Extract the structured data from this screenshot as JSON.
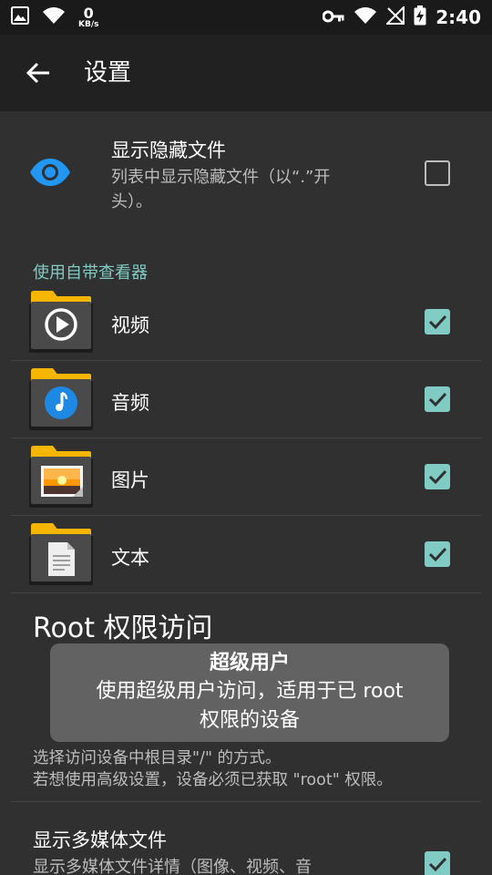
{
  "status_bar": {
    "net_speed_value": "0",
    "net_speed_unit": "KB/s",
    "time": "2:40"
  },
  "app_bar": {
    "title": "设置"
  },
  "hidden_files": {
    "title": "显示隐藏文件",
    "summary_line1": "列表中显示隐藏文件（以“.”开",
    "summary_line2": "头）。",
    "checked": false
  },
  "viewer_category": "使用自带查看器",
  "viewers": [
    {
      "label": "视频",
      "icon": "video-folder-icon",
      "checked": true
    },
    {
      "label": "音频",
      "icon": "audio-folder-icon",
      "checked": true
    },
    {
      "label": "图片",
      "icon": "image-folder-icon",
      "checked": true
    },
    {
      "label": "文本",
      "icon": "text-folder-icon",
      "checked": true
    }
  ],
  "root_access": {
    "title": "Root 权限访问",
    "summary_line1": "选择访问设备中根目录\"/\" 的方式。",
    "summary_line2": "若想使用高级设置，设备必须已获取 \"root\" 权限。"
  },
  "tooltip": {
    "title": "超级用户",
    "line1": "使用超级用户访问，适用于已 root",
    "line2": "权限的设备"
  },
  "media_files": {
    "title": "显示多媒体文件",
    "summary_line1": "显示多媒体文件详情（图像、视频、音",
    "checked": true
  },
  "colors": {
    "accent": "#80cbc4",
    "folder": "#f6b500",
    "background": "#303030",
    "app_bar": "#212121"
  }
}
